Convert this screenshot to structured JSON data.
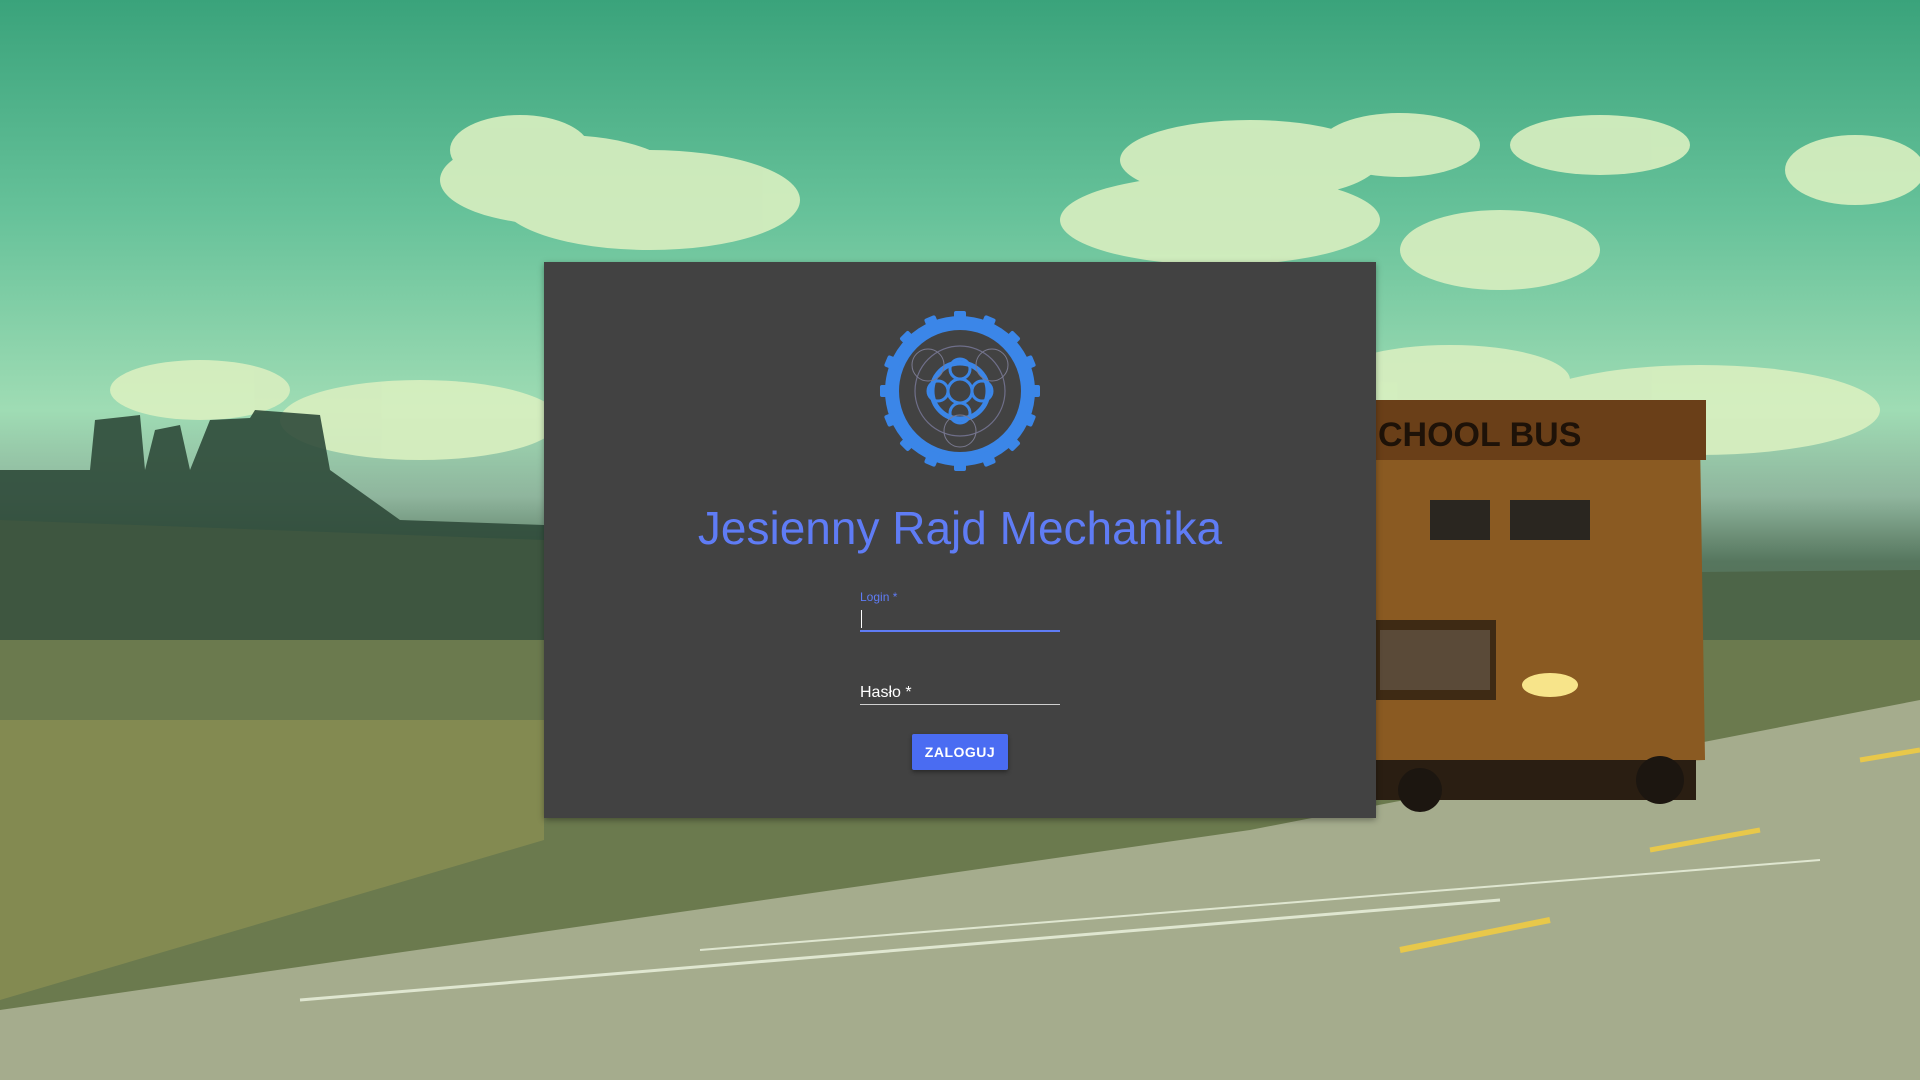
{
  "app": {
    "title": "Jesienny Rajd Mechanika"
  },
  "background": {
    "bus_sign": "CHOOL BUS"
  },
  "login_form": {
    "login_label": "Login *",
    "login_value": "",
    "password_label": "Hasło *",
    "password_value": "",
    "submit_label": "ZALOGUJ"
  },
  "colors": {
    "accent": "#5f7cf5",
    "button": "#4a6cf2",
    "card": "#424242",
    "logo": "#3b86e8"
  },
  "icons": {
    "logo": "gears-logo-icon"
  }
}
